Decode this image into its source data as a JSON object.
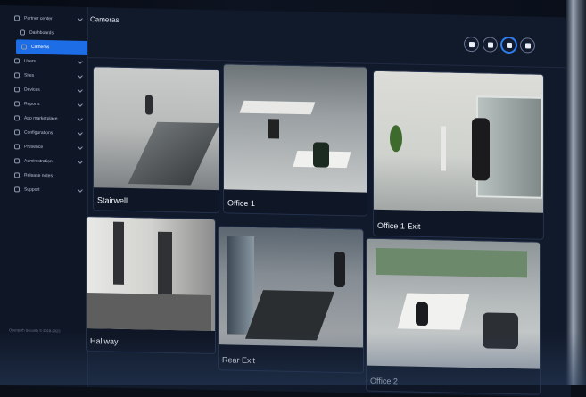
{
  "sidebar": {
    "items": [
      {
        "label": "Partner center",
        "icon": "building-icon"
      },
      {
        "label": "Dashboards",
        "icon": "dashboard-icon"
      },
      {
        "label": "Cameras",
        "icon": "camera-icon"
      },
      {
        "label": "Users",
        "icon": "user-icon"
      },
      {
        "label": "Sites",
        "icon": "pin-icon"
      },
      {
        "label": "Devices",
        "icon": "monitor-icon"
      },
      {
        "label": "Reports",
        "icon": "document-icon"
      },
      {
        "label": "App marketplace",
        "icon": "gear-icon"
      },
      {
        "label": "Configurations",
        "icon": "sliders-icon"
      },
      {
        "label": "Presence",
        "icon": "presence-icon"
      },
      {
        "label": "Administration",
        "icon": "admin-icon"
      },
      {
        "label": "Release notes",
        "icon": "notes-icon"
      },
      {
        "label": "Support",
        "icon": "support-icon"
      }
    ],
    "footer": "Openpath Security © 2018-2023"
  },
  "header": {
    "title": "Cameras"
  },
  "view_toggles": [
    "single",
    "2x2",
    "3x3",
    "4x4"
  ],
  "cameras": [
    {
      "name": "Stairwell"
    },
    {
      "name": "Office 1"
    },
    {
      "name": "Office 1 Exit"
    },
    {
      "name": "Hallway"
    },
    {
      "name": "Rear Exit"
    },
    {
      "name": "Office 2"
    }
  ]
}
